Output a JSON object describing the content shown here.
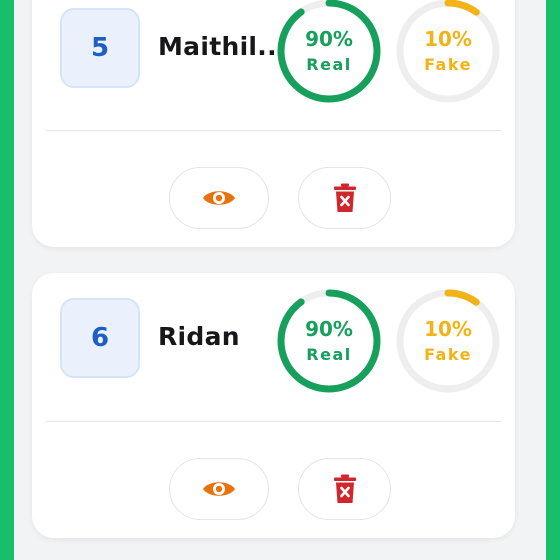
{
  "colors": {
    "page_background": "#18be6a",
    "panel_background": "#f1f3f5",
    "card_background": "#ffffff",
    "number_text": "#1e5fc4",
    "real": "#16a05c",
    "fake": "#f2b316",
    "view_icon": "#e8730c",
    "delete_icon": "#d0272d",
    "ring_track": "#eeeeee"
  },
  "records": [
    {
      "number": "5",
      "name": "Maithil...",
      "real": {
        "percent_label": "90%",
        "label": "Real",
        "value": 0.9
      },
      "fake": {
        "percent_label": "10%",
        "label": "Fake",
        "value": 0.1
      },
      "actions": {
        "view": "eye-icon",
        "delete": "trash-icon"
      }
    },
    {
      "number": "6",
      "name": "Ridan",
      "real": {
        "percent_label": "90%",
        "label": "Real",
        "value": 0.9
      },
      "fake": {
        "percent_label": "10%",
        "label": "Fake",
        "value": 0.1
      },
      "actions": {
        "view": "eye-icon",
        "delete": "trash-icon"
      }
    }
  ]
}
